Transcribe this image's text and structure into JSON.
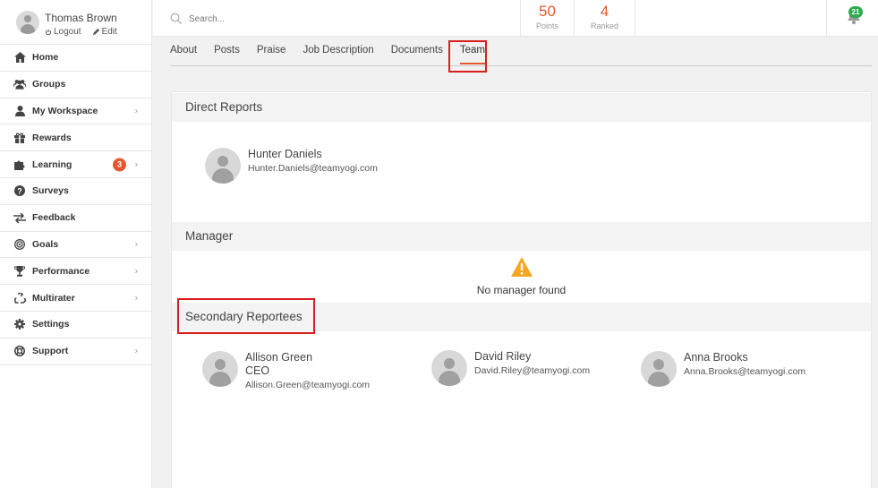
{
  "profile": {
    "name": "Thomas Brown",
    "logout_label": "Logout",
    "edit_label": "Edit"
  },
  "sidebar": {
    "items": [
      {
        "label": "Home",
        "icon": "home-icon"
      },
      {
        "label": "Groups",
        "icon": "users-icon"
      },
      {
        "label": "My Workspace",
        "icon": "user-icon",
        "chevron": true
      },
      {
        "label": "Rewards",
        "icon": "gift-icon"
      },
      {
        "label": "Learning",
        "icon": "puzzle-icon",
        "chevron": true,
        "badge": "3"
      },
      {
        "label": "Surveys",
        "icon": "question-icon"
      },
      {
        "label": "Feedback",
        "icon": "exchange-icon"
      },
      {
        "label": "Goals",
        "icon": "target-icon",
        "chevron": true
      },
      {
        "label": "Performance",
        "icon": "trophy-icon",
        "chevron": true
      },
      {
        "label": "Multirater",
        "icon": "recycle-icon",
        "chevron": true
      },
      {
        "label": "Settings",
        "icon": "gear-icon"
      },
      {
        "label": "Support",
        "icon": "lifebuoy-icon",
        "chevron": true
      }
    ]
  },
  "search": {
    "placeholder": "Search..."
  },
  "stats": {
    "points_value": "50",
    "points_label": "Points",
    "ranked_value": "4",
    "ranked_label": "Ranked"
  },
  "notifications": {
    "count": "21"
  },
  "tabs": [
    "About",
    "Posts",
    "Praise",
    "Job Description",
    "Documents",
    "Team"
  ],
  "active_tab": "Team",
  "sections": {
    "direct_reports": {
      "title": "Direct Reports",
      "people": [
        {
          "name": "Hunter Daniels",
          "email": "Hunter.Daniels@teamyogi.com"
        }
      ]
    },
    "manager": {
      "title": "Manager",
      "empty_text": "No manager found"
    },
    "secondary": {
      "title": "Secondary Reportees",
      "people": [
        {
          "name": "Allison Green",
          "title": "CEO",
          "email": "Allison.Green@teamyogi.com"
        },
        {
          "name": "David Riley",
          "email": "David.Riley@teamyogi.com"
        },
        {
          "name": "Anna Brooks",
          "email": "Anna.Brooks@teamyogi.com"
        }
      ]
    }
  },
  "colors": {
    "accent": "#e4572e",
    "highlight_box": "#d81e1e",
    "notification_badge": "#2eaa4f",
    "warning": "#f5a623"
  }
}
